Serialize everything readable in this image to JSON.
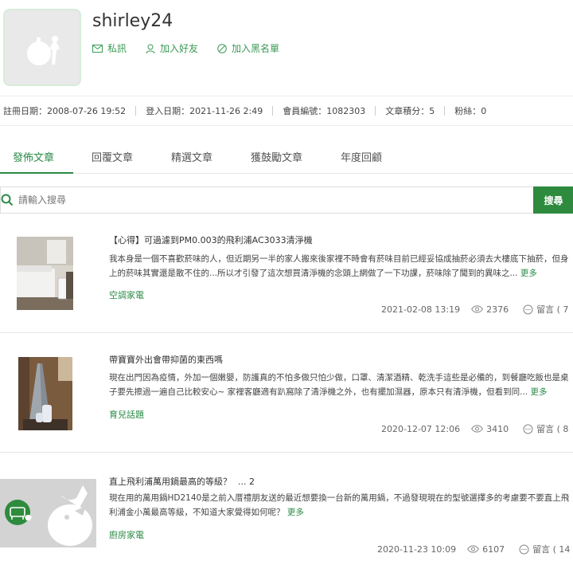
{
  "profile": {
    "username": "shirley24",
    "actions": {
      "message": "私訊",
      "add_friend": "加入好友",
      "blacklist": "加入黑名單"
    }
  },
  "stats": {
    "register_date": "註冊日期：2008-07-26 19:52",
    "login_date": "登入日期：2021-11-26 2:49",
    "member_id": "會員編號：1082303",
    "article_points": "文章積分：5",
    "fans": "粉絲：0"
  },
  "tabs": [
    "發佈文章",
    "回覆文章",
    "精選文章",
    "獲鼓勵文章",
    "年度回顧"
  ],
  "search": {
    "placeholder": "請輸入搜尋",
    "button_label": "搜尋"
  },
  "articles": [
    {
      "title": "【心得】可過濾到PM0.003的飛利浦AC3033清淨機",
      "excerpt": "我本身是一個不喜歡菸味的人，但近期另一半的家人搬來後家裡不時會有菸味目前已經妥協成抽菸必須去大樓底下抽菸，但身上的菸味其實還是散不住的...所以才引發了這次想買清淨機的念頭上網做了一下功課，菸味除了聞到的異味之...",
      "more": "更多",
      "category": "空調家電",
      "date": "2021-02-08 13:19",
      "views": "2376",
      "comments": "留言 ( 7"
    },
    {
      "title": "帶寶寶外出會帶抑菌的東西嗎",
      "excerpt": "現在出門因為疫情，外加一個嫩嬰，防護真的不怕多做只怕少做，口罩、清潔酒精、乾洗手這些是必備的，到餐廳吃飯也是桌子要先擦過一遍自己比較安心~ 家裡客廳適有趴窩除了清淨機之外，也有擺加濕器，原本只有清淨機，但看到同...",
      "more": "更多",
      "category": "育兒話題",
      "date": "2020-12-07 12:06",
      "views": "3410",
      "comments": "留言 ( 8"
    },
    {
      "title": "直上飛利浦萬用鍋最高的等級？",
      "page_nav": "... 2",
      "excerpt": "現在用的萬用鍋HD2140是之前入厝禮朋友送的最近想要換一台新的萬用鍋，不過發現現在的型號選擇多的考慮要不要直上飛利浦金小萬最高等級，不知道大家覺得如何呢？",
      "more": "更多",
      "category": "廚房家電",
      "date": "2020-11-23 10:09",
      "views": "6107",
      "comments": "留言 ( 14"
    }
  ],
  "colors": {
    "accent": "#2b8a47",
    "search_button": "#2e8b3e",
    "avatar_border": "#d7ecd9"
  }
}
